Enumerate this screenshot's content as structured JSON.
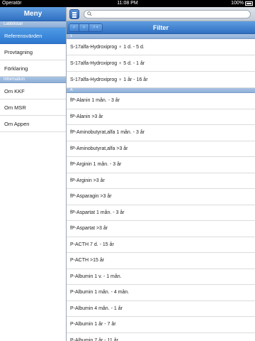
{
  "status": {
    "carrier": "Operatör",
    "time": "11:08 PM",
    "battery": "100%"
  },
  "sidebar": {
    "title": "Meny",
    "sections": [
      {
        "header": "Labblistan",
        "items": [
          {
            "label": "Referensvärden",
            "selected": true
          },
          {
            "label": "Provtagning",
            "selected": false
          },
          {
            "label": "Förklaring",
            "selected": false
          }
        ]
      },
      {
        "header": "Information",
        "items": [
          {
            "label": "Om KKF",
            "selected": false
          },
          {
            "label": "Om MSR",
            "selected": false
          },
          {
            "label": "Om Appen",
            "selected": false
          }
        ]
      }
    ]
  },
  "search": {
    "placeholder": "",
    "value": ""
  },
  "filterbar": {
    "title": "Filter",
    "segments": [
      "♂",
      "♀",
      "♂♀"
    ]
  },
  "list": {
    "sections": [
      {
        "header": "1",
        "items": [
          "S-17alfa-Hydroxiprog ♀ 1 d. - 5 d.",
          "S-17alfa-Hydroxiprog ♀ 5 d. - 1 år",
          "S-17alfa-Hydroxiprog ♀ 1 år - 16 år"
        ]
      },
      {
        "header": "A",
        "items": [
          "fP-Alanin 1 mån. - 3 år",
          "fP-Alanin >3 år",
          "fP-Aminobutyrat,alfa 1 mån. - 3 år",
          "fP-Aminobutyrat,alfa >3 år",
          "fP-Arginin 1 mån. - 3 år",
          "fP-Arginin >3 år",
          "fP-Asparagin >3 år",
          "fP-Aspartat 1 mån. - 3 år",
          "fP-Aspartat >3 år",
          "P-ACTH 7 d. - 15 år",
          "P-ACTH >15 år",
          "P-Albumin 1 v. - 1 mån.",
          "P-Albumin 1 mån. - 4 mån.",
          "P-Albumin 4 mån. - 1 år",
          "P-Albumin 1 år - 7 år",
          "P-Albumin 7 år - 11 år"
        ]
      }
    ]
  }
}
